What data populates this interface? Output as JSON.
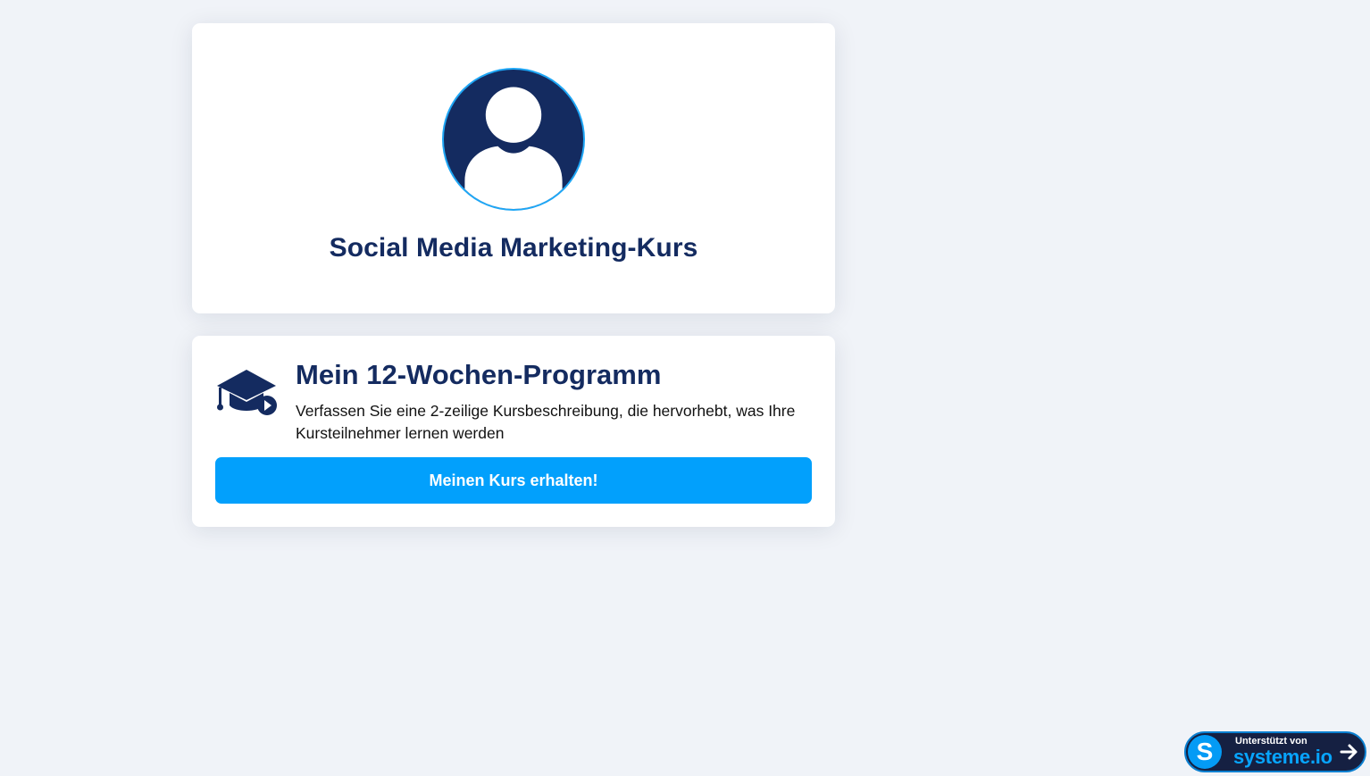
{
  "profile": {
    "title": "Social Media Marketing-Kurs"
  },
  "course": {
    "title": "Mein 12-Wochen-Programm",
    "description": "Verfassen Sie eine 2-zeilige Kursbeschreibung, die hervorhebt, was Ihre Kursteilnehmer lernen werden",
    "button_label": "Meinen Kurs erhalten!"
  },
  "badge": {
    "logo_letter": "S",
    "small_text": "Unterstützt von",
    "brand": "systeme.io"
  },
  "icons": {
    "avatar": "user-avatar-icon",
    "course": "graduation-cap-icon",
    "badge_arrow": "arrow-right-icon"
  },
  "colors": {
    "navy": "#142b60",
    "accent": "#02a0fc",
    "background": "#f0f3f8"
  }
}
